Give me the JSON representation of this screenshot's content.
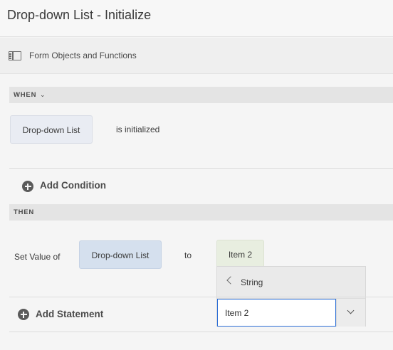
{
  "header": {
    "title": "Drop-down List - Initialize"
  },
  "objects_bar": {
    "label": "Form Objects and Functions",
    "icon": "panel-icon"
  },
  "when": {
    "label": "WHEN",
    "subject": "Drop-down List",
    "event": "is initialized",
    "add_condition": "Add Condition"
  },
  "then": {
    "label": "THEN",
    "action": "Set Value of",
    "target": "Drop-down List",
    "connector": "to",
    "value_chip": "Item 2",
    "dropdown": {
      "type_label": "String",
      "input_value": "Item 2"
    },
    "add_statement": "Add Statement"
  }
}
